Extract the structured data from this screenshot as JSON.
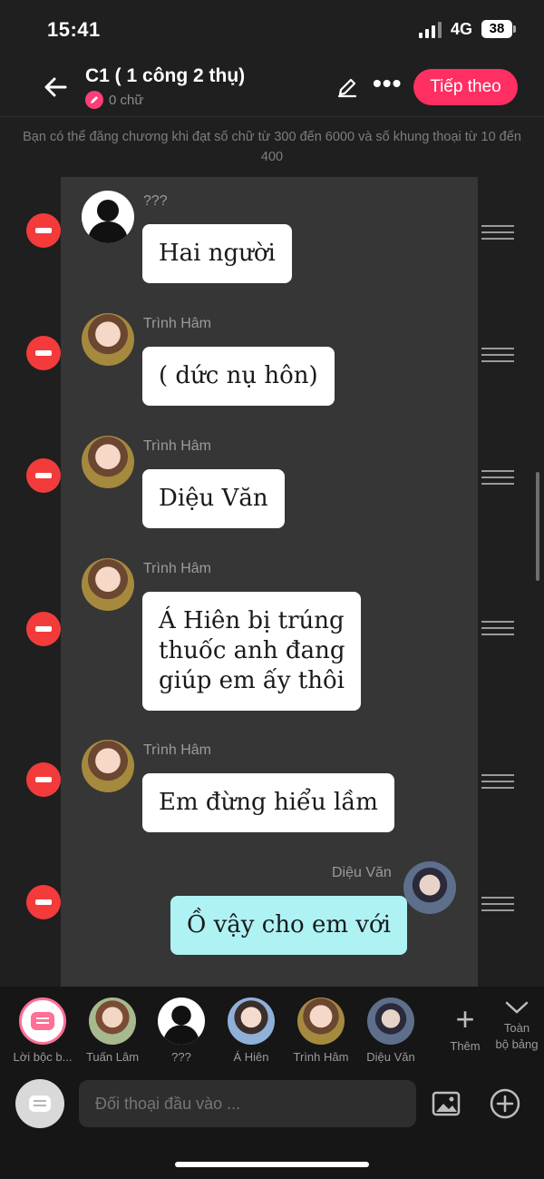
{
  "status_bar": {
    "time": "15:41",
    "network": "4G",
    "battery": "38"
  },
  "header": {
    "title": "C1 ( 1 công 2 thụ)",
    "word_count": "0 chữ",
    "next_label": "Tiếp theo"
  },
  "notice": "Bạn có thể đăng chương khi đạt số chữ từ 300 đến 6000 và số khung thoại từ 10 đến 400",
  "messages": [
    {
      "sender": "???",
      "text": "Hai người",
      "avatar": "silhouette-avatar",
      "side": "left"
    },
    {
      "sender": "Trình Hâm",
      "text": "( dức nụ hôn)",
      "avatar": "trinh-ham-avatar",
      "side": "left"
    },
    {
      "sender": "Trình Hâm",
      "text": "Diệu Văn",
      "avatar": "trinh-ham-avatar",
      "side": "left"
    },
    {
      "sender": "Trình Hâm",
      "text_lines": [
        "Á Hiên bị trúng",
        "thuốc anh đang",
        "giúp em ấy thôi"
      ],
      "avatar": "trinh-ham-avatar",
      "side": "left"
    },
    {
      "sender": "Trình Hâm",
      "text": "Em đừng hiểu lầm",
      "avatar": "trinh-ham-avatar",
      "side": "left"
    },
    {
      "sender": "Diệu Văn",
      "text": "Ồ vậy cho em với",
      "avatar": "dieu-van-avatar",
      "side": "right"
    }
  ],
  "characters": [
    {
      "name": "Lời bộc b...",
      "avatar": "narration-icon"
    },
    {
      "name": "Tuấn Lâm",
      "avatar": "tuan-lam-avatar"
    },
    {
      "name": "???",
      "avatar": "silhouette-avatar"
    },
    {
      "name": "Á Hiên",
      "avatar": "a-hien-avatar"
    },
    {
      "name": "Trình Hâm",
      "avatar": "trinh-ham-avatar"
    },
    {
      "name": "Diệu Văn",
      "avatar": "dieu-van-avatar"
    }
  ],
  "add_label": "Thêm",
  "all_label_line1": "Toàn",
  "all_label_line2": "bộ bảng",
  "input": {
    "placeholder": "Đối thoại đầu vào ..."
  },
  "colors": {
    "accent": "#ff2f63",
    "delete": "#f33b3b",
    "my_bubble": "#aef2f4"
  }
}
